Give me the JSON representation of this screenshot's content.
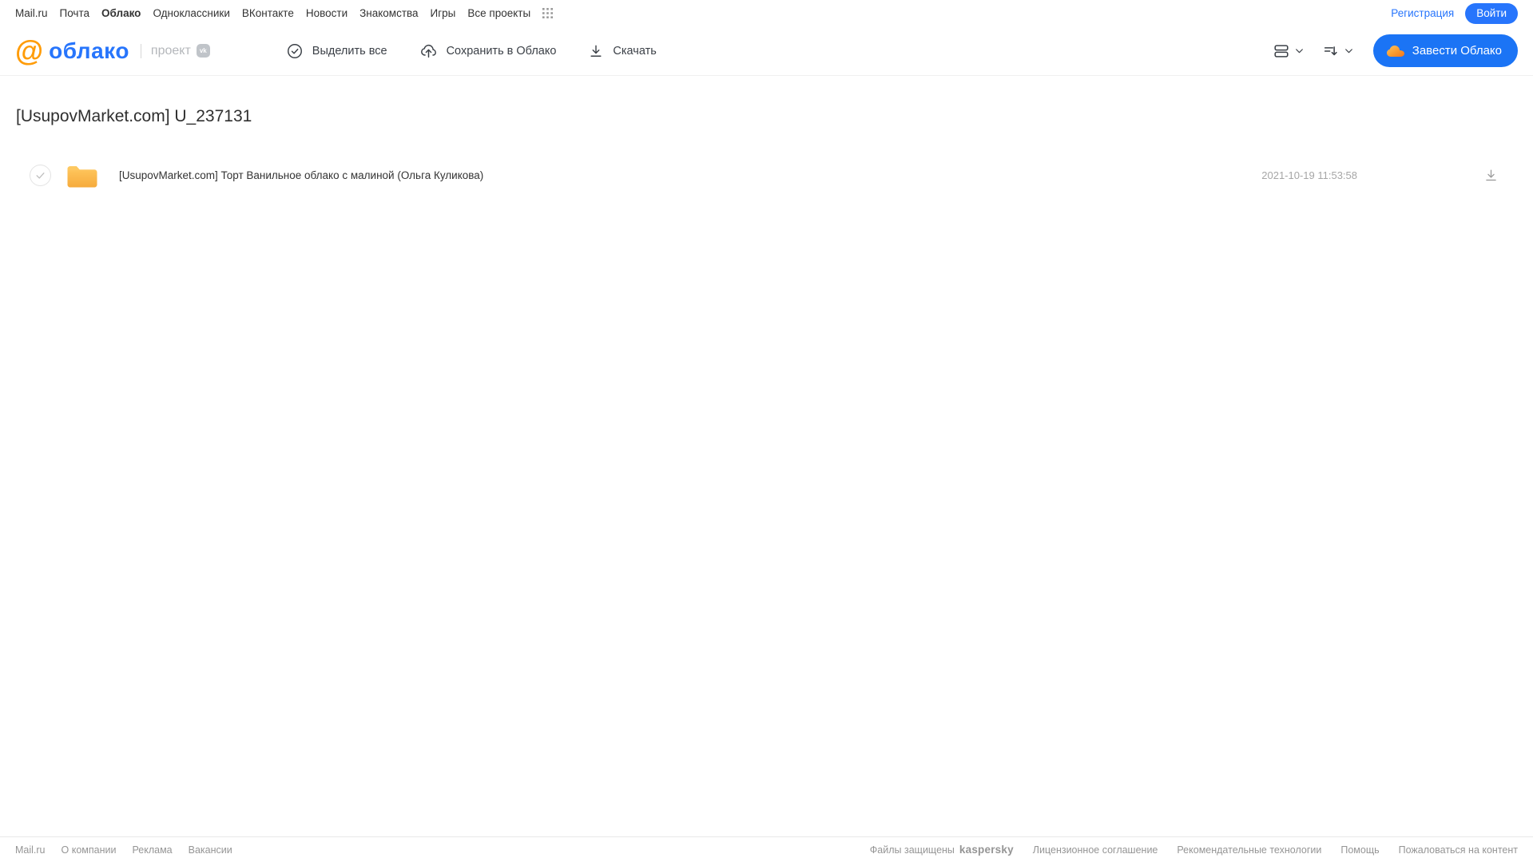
{
  "topnav": {
    "items": [
      "Mail.ru",
      "Почта",
      "Облако",
      "Одноклассники",
      "ВКонтакте",
      "Новости",
      "Знакомства",
      "Игры",
      "Все проекты"
    ],
    "current_item": "Облако",
    "registration_label": "Регистрация",
    "login_label": "Войти"
  },
  "toolbar": {
    "logo_at": "@",
    "logo_text": "облако",
    "project_label": "проект",
    "vk_badge": "vk",
    "select_all_label": "Выделить все",
    "save_label": "Сохранить в Облако",
    "download_label": "Скачать",
    "create_cloud_label": "Завести Облако"
  },
  "main": {
    "title": "[UsupovMarket.com] U_237131",
    "files": [
      {
        "type": "folder",
        "name": "[UsupovMarket.com] Торт Ванильное облако с малиной (Ольга Куликова)",
        "date": "2021-10-19 11:53:58"
      }
    ]
  },
  "footer": {
    "left_links": [
      "Mail.ru",
      "О компании",
      "Реклама",
      "Вакансии"
    ],
    "protected_text": "Файлы защищены",
    "kaspersky_label": "kaspersky",
    "right_links": [
      "Лицензионное соглашение",
      "Рекомендательные технологии",
      "Помощь",
      "Пожаловаться на контент"
    ]
  },
  "icons": {
    "all_projects": "grid-3x3-dots",
    "select_all": "check-circle",
    "save": "cloud-upload",
    "download": "arrow-down-underline",
    "view_mode": "stacked-rows",
    "sort": "sort-lines-arrow-down",
    "chevron": "chevron-down",
    "cta_cloud": "orange-cloud",
    "file": "folder",
    "row_check": "checkmark",
    "row_download": "arrow-down-underline"
  },
  "colors": {
    "accent_blue": "#1b74f5",
    "logo_blue": "#2775fc",
    "logo_orange": "#ff9c08",
    "folder_yellow": "#f9b64a",
    "kaspersky_teal": "#009982",
    "text_dark": "#333333",
    "text_muted": "#a6a6a6"
  }
}
